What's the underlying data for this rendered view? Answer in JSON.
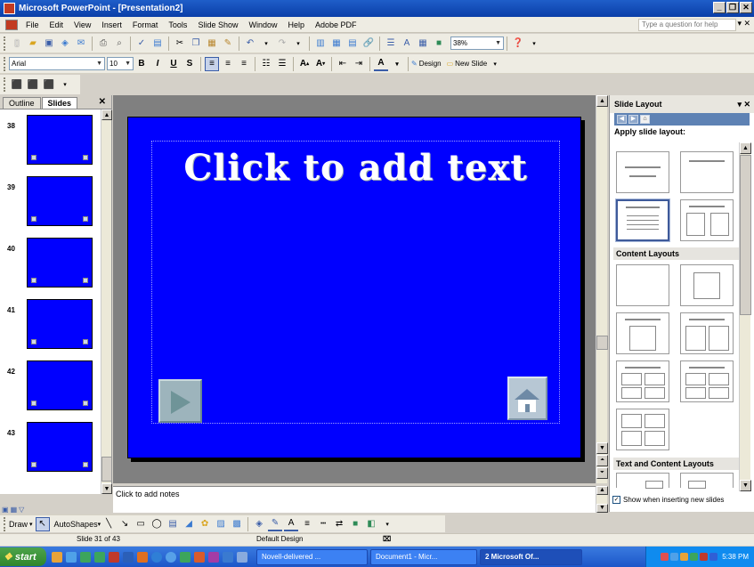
{
  "window": {
    "title": "Microsoft PowerPoint - [Presentation2]"
  },
  "menu": {
    "items": [
      "File",
      "Edit",
      "View",
      "Insert",
      "Format",
      "Tools",
      "Slide Show",
      "Window",
      "Help",
      "Adobe PDF"
    ],
    "help_placeholder": "Type a question for help"
  },
  "toolbar": {
    "zoom": "38%"
  },
  "formatting": {
    "font": "Arial",
    "size": "10",
    "design_label": "Design",
    "new_slide_label": "New Slide"
  },
  "left_panel": {
    "tabs": [
      "Outline",
      "Slides"
    ],
    "slide_numbers": [
      "38",
      "39",
      "40",
      "41",
      "42",
      "43"
    ]
  },
  "slide": {
    "title_text": "Click to add text",
    "background_color": "#0000ff"
  },
  "notes": {
    "placeholder": "Click to add notes"
  },
  "task_pane": {
    "title": "Slide Layout",
    "apply_label": "Apply slide layout:",
    "section_content": "Content Layouts",
    "section_text_content": "Text and Content Layouts",
    "show_when_inserting": "Show when inserting new slides"
  },
  "draw_toolbar": {
    "draw_label": "Draw",
    "autoshapes_label": "AutoShapes"
  },
  "status": {
    "slide_position": "Slide 31 of 43",
    "design": "Default Design"
  },
  "taskbar": {
    "start": "start",
    "tasks": [
      "Novell-delivered ...",
      "Document1 - Micr...",
      "2 Microsoft Of..."
    ],
    "clock": "5:38 PM"
  }
}
